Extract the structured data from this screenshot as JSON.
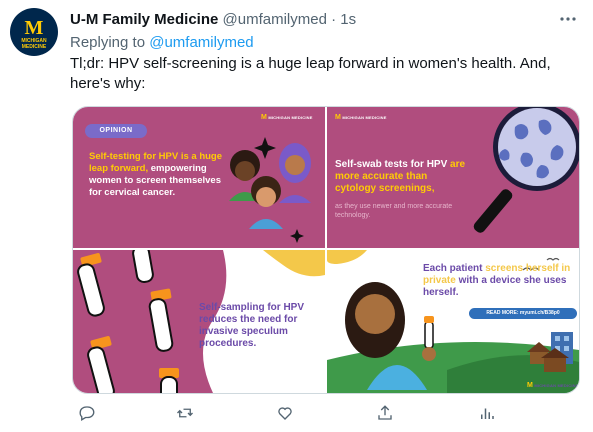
{
  "tweet": {
    "author_name": "U-M Family Medicine",
    "author_handle": "@umfamilymed",
    "separator": "·",
    "time": "1s",
    "more_icon": "more-icon",
    "avatar": {
      "letter": "M",
      "line1": "MICHIGAN",
      "line2": "MEDICINE",
      "bg": "#00274c",
      "accent": "#ffcb05"
    },
    "replying_prefix": "Replying to",
    "replying_handle": "@umfamilymed",
    "text": "Tl;dr: HPV self-screening is a huge leap forward in women's health. And, here's why:"
  },
  "media": {
    "panel1": {
      "badge": "OPINION",
      "highlight": "Self-testing for HPV is a huge leap forward,",
      "rest": " empowering women to screen themselves for cervical cancer.",
      "logo_text": "MICHIGAN MEDICINE"
    },
    "panel2": {
      "line_a": "Self-swab tests for HPV",
      "highlight": "are more accurate than cytology screenings,",
      "sub": "as they use newer and more accurate technology.",
      "logo_text": "MICHIGAN MEDICINE"
    },
    "panel3": {
      "text": "Self-sampling for HPV reduces the need for invasive speculum procedures."
    },
    "panel4": {
      "line_a": "Each patient",
      "highlight1": "screens herself in private",
      "line_b": "with a device she uses herself.",
      "readmore": "READ MORE: myumi.ch/B38p0",
      "logo_text": "MICHIGAN MEDICINE"
    },
    "colors": {
      "magenta": "#b04d7e",
      "yellow": "#ffcb05",
      "purple": "#6b4aa8",
      "orange": "#f7941d"
    }
  },
  "actions": {
    "reply_icon": "reply-icon",
    "retweet_icon": "retweet-icon",
    "like_icon": "like-icon",
    "share_icon": "share-icon",
    "analytics_icon": "analytics-icon"
  }
}
